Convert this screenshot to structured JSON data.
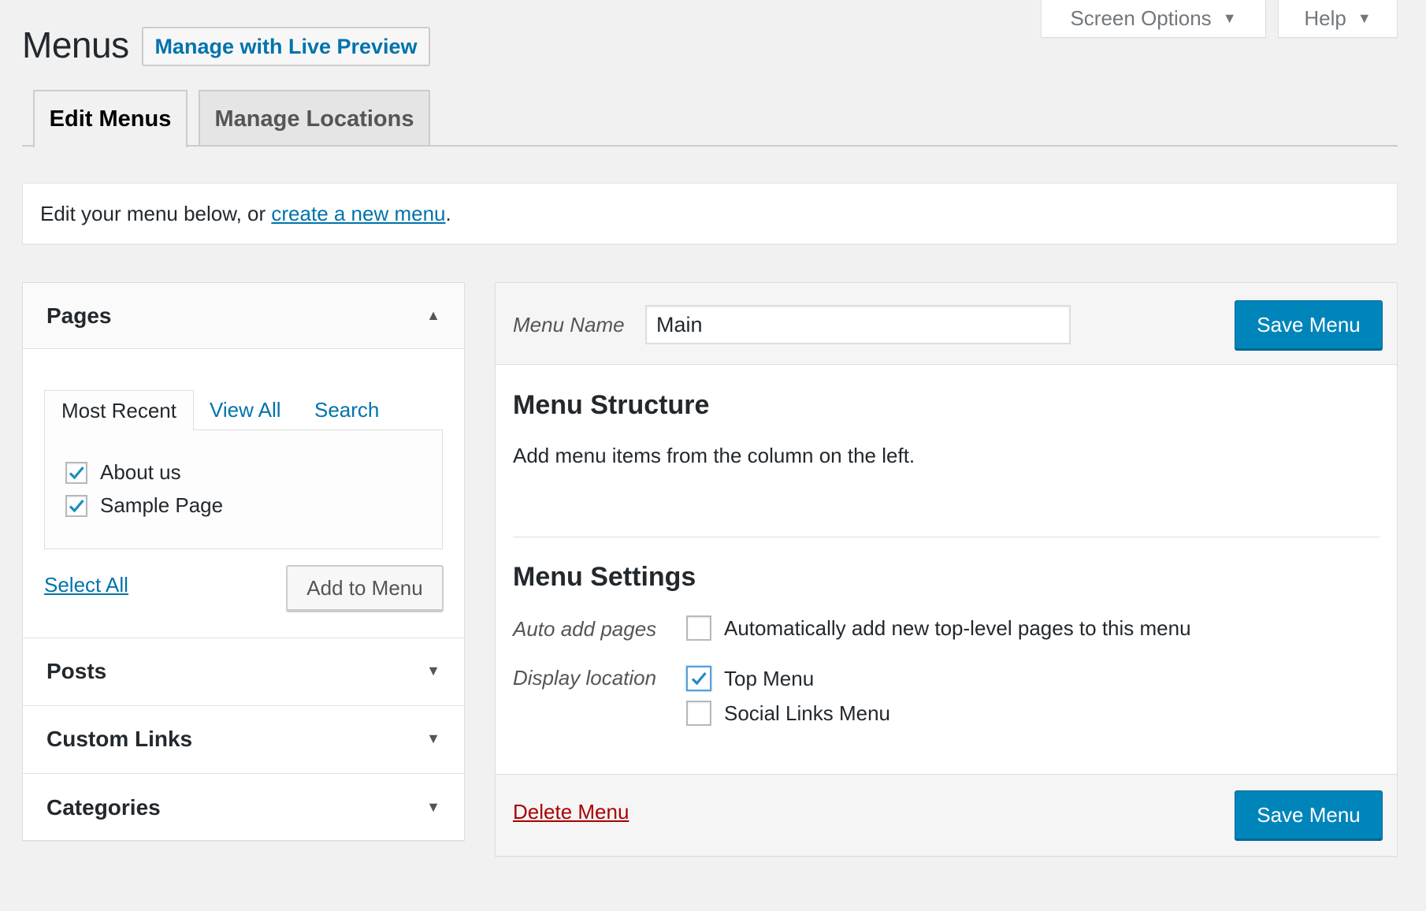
{
  "header": {
    "title": "Menus",
    "live_preview_label": "Manage with Live Preview",
    "screen_options_label": "Screen Options",
    "help_label": "Help"
  },
  "tabs": [
    {
      "label": "Edit Menus",
      "active": true
    },
    {
      "label": "Manage Locations",
      "active": false
    }
  ],
  "notice": {
    "text_before": "Edit your menu below, or ",
    "link_text": "create a new menu",
    "text_after": "."
  },
  "left_panel": {
    "sections": [
      {
        "title": "Pages",
        "expanded": true
      },
      {
        "title": "Posts",
        "expanded": false
      },
      {
        "title": "Custom Links",
        "expanded": false
      },
      {
        "title": "Categories",
        "expanded": false
      }
    ],
    "page_tabs": [
      "Most Recent",
      "View All",
      "Search"
    ],
    "pages": [
      {
        "label": "About us",
        "checked": true
      },
      {
        "label": "Sample Page",
        "checked": true
      }
    ],
    "select_all_label": "Select All",
    "add_to_menu_label": "Add to Menu"
  },
  "menu_editor": {
    "menu_name_label": "Menu Name",
    "menu_name_value": "Main",
    "save_label": "Save Menu",
    "structure_title": "Menu Structure",
    "structure_instructions": "Add menu items from the column on the left.",
    "settings_title": "Menu Settings",
    "auto_add_label": "Auto add pages",
    "auto_add_option": "Automatically add new top-level pages to this menu",
    "auto_add_checked": false,
    "display_location_label": "Display location",
    "locations": [
      {
        "label": "Top Menu",
        "checked": true
      },
      {
        "label": "Social Links Menu",
        "checked": false
      }
    ],
    "delete_label": "Delete Menu"
  },
  "colors": {
    "accent": "#0073aa",
    "primary_button": "#0085ba",
    "delete": "#aa0000",
    "background": "#f1f1f1"
  }
}
